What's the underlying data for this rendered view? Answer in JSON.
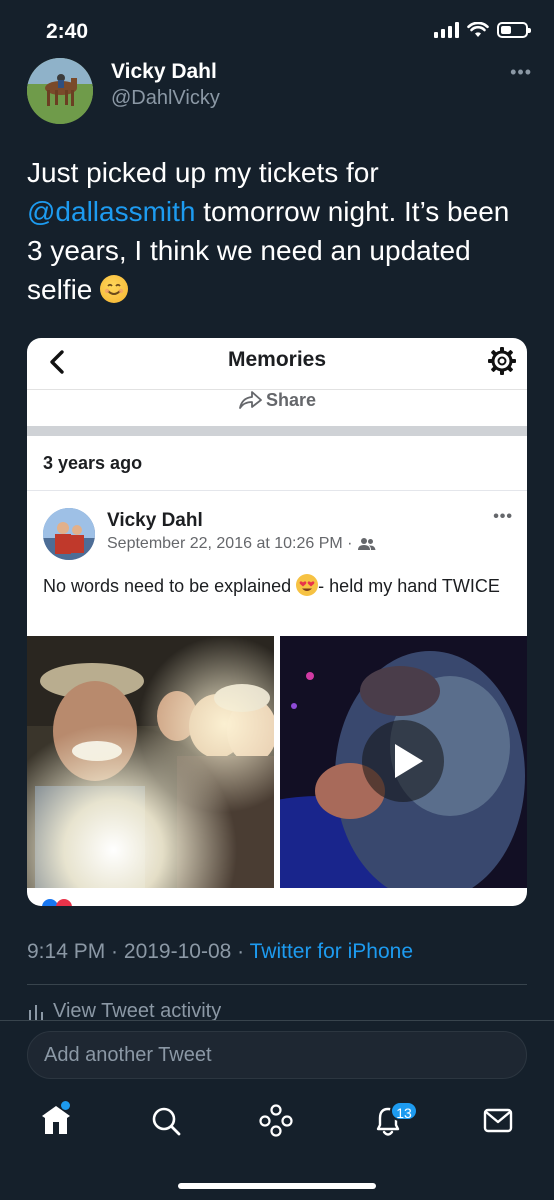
{
  "status_bar": {
    "time": "2:40"
  },
  "author": {
    "name": "Vicky Dahl",
    "handle": "@DahlVicky",
    "more": "•••"
  },
  "tweet": {
    "text_before": "Just picked up my tickets for ",
    "mention": "@dallassmith",
    "text_after": " tomorrow night. It’s been 3 years, I think we need an updated selfie",
    "emoji": "smiling-face"
  },
  "memory_card": {
    "back_icon": "chevron-left-icon",
    "title": "Memories",
    "settings_icon": "gear-icon",
    "share_label": "Share",
    "years_ago": "3 years ago",
    "post": {
      "author": "Vicky Dahl",
      "date": "September 22, 2016 at 10:26 PM ·",
      "audience_icon": "friends-icon",
      "more": "•••",
      "text_before": "No words need to be explained ",
      "emoji": "heart-eyes-face",
      "text_after": "- held my hand TWICE"
    }
  },
  "meta": {
    "time": "9:14 PM",
    "separator1": " · ",
    "date": "2019-10-08",
    "separator2": " · ",
    "source": "Twitter for iPhone",
    "activity": "View Tweet activity"
  },
  "compose": {
    "placeholder": "Add another Tweet"
  },
  "tab_bar": {
    "items": [
      "home-icon",
      "search-icon",
      "spaces-icon",
      "notifications-icon",
      "messages-icon"
    ],
    "notification_count": "13"
  },
  "colors": {
    "background": "#15202b",
    "accent": "#1d9bf0",
    "secondary_text": "#8b98a5"
  }
}
